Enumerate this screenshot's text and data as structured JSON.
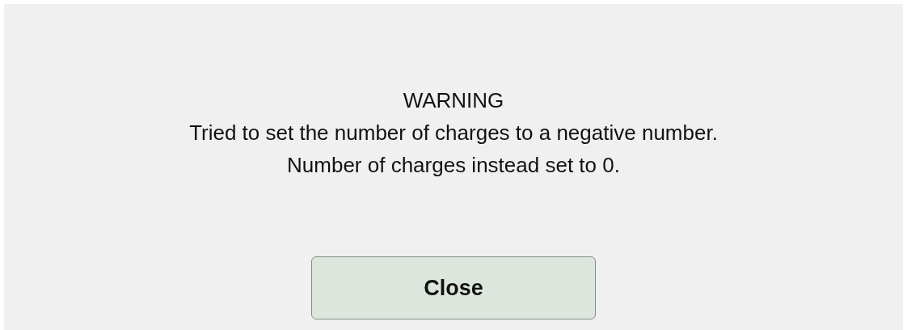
{
  "dialog": {
    "title": "WARNING",
    "message_lines": [
      "Tried to set the number of charges to a negative number.",
      "Number of charges instead set to 0."
    ],
    "buttons": [
      {
        "label": "Close"
      }
    ]
  }
}
